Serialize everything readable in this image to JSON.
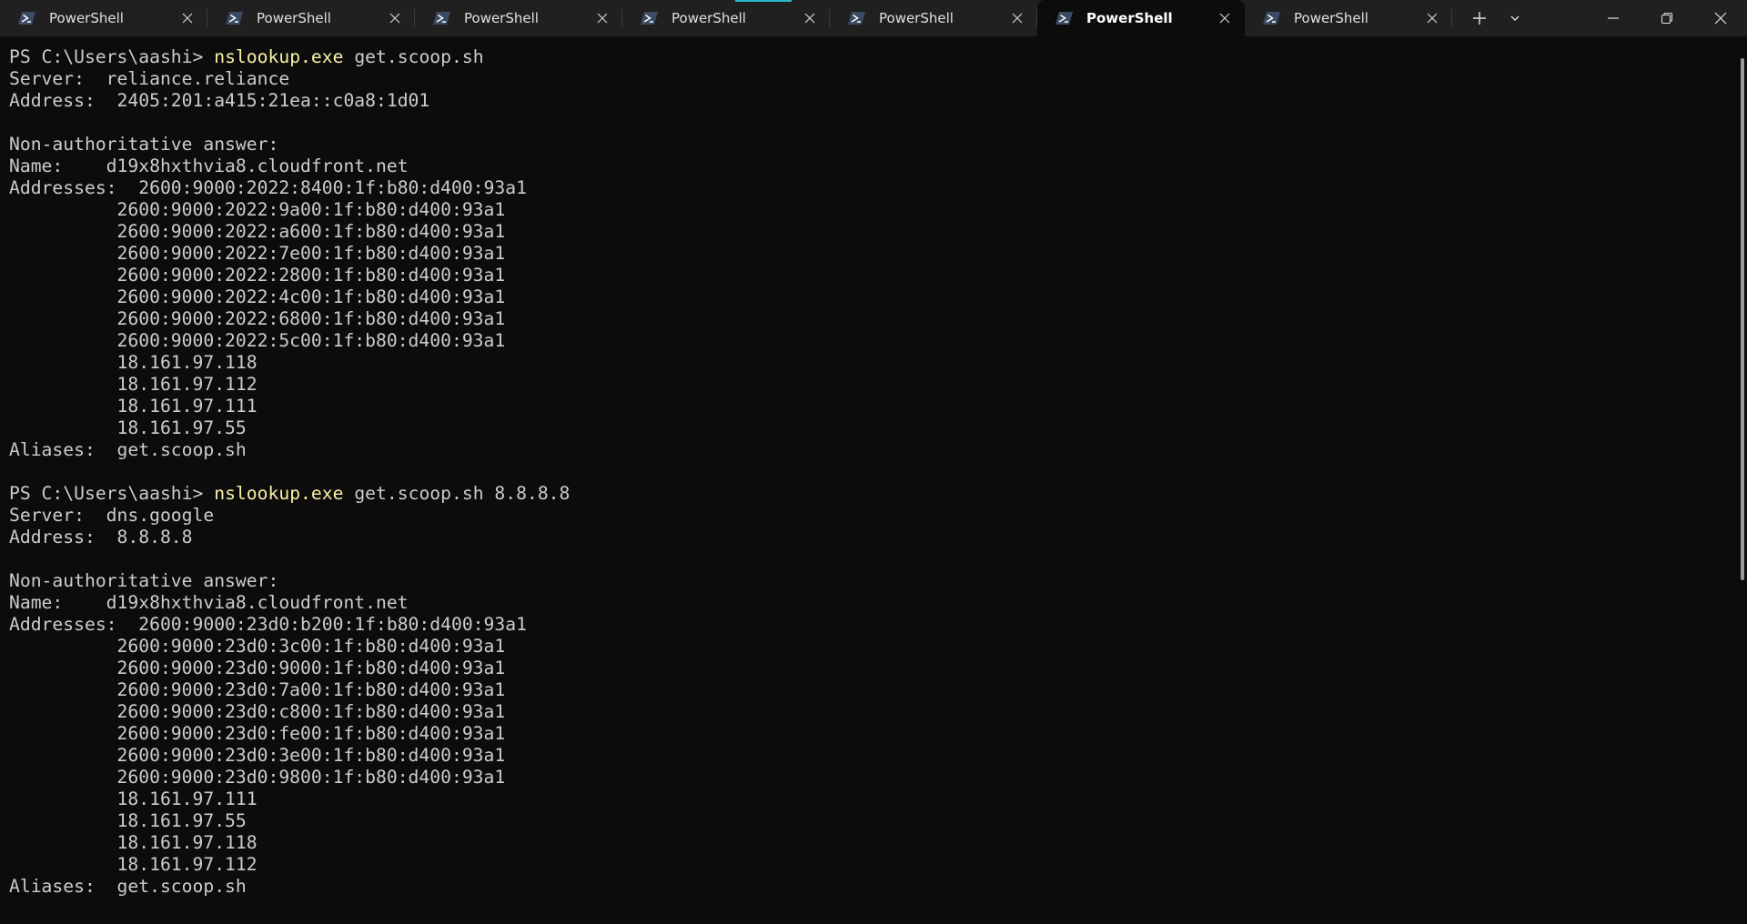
{
  "window": {
    "tabs": [
      {
        "label": "PowerShell",
        "active": false
      },
      {
        "label": "PowerShell",
        "active": false
      },
      {
        "label": "PowerShell",
        "active": false
      },
      {
        "label": "PowerShell",
        "active": false
      },
      {
        "label": "PowerShell",
        "active": false
      },
      {
        "label": "PowerShell",
        "active": true
      },
      {
        "label": "PowerShell",
        "active": false
      }
    ],
    "icons": {
      "tab_icon": "powershell-icon",
      "tab_close": "close-icon",
      "new_tab": "plus-icon",
      "dropdown": "chevron-down-icon",
      "minimize": "minimize-icon",
      "maximize": "restore-icon",
      "close": "close-icon"
    },
    "colors": {
      "background": "#0c0c0c",
      "titlebar": "#202020",
      "text": "#cccccc",
      "command": "#f9f1a5",
      "accent": "#2bb8c8"
    }
  },
  "terminal": {
    "lines": [
      {
        "pre": "PS C:\\Users\\aashi> ",
        "cmd": "nslookup.exe",
        "post": " get.scoop.sh"
      },
      {
        "pre": "Server:  reliance.reliance"
      },
      {
        "pre": "Address:  2405:201:a415:21ea::c0a8:1d01"
      },
      {
        "pre": ""
      },
      {
        "pre": "Non-authoritative answer:"
      },
      {
        "pre": "Name:    d19x8hxthvia8.cloudfront.net"
      },
      {
        "pre": "Addresses:  2600:9000:2022:8400:1f:b80:d400:93a1"
      },
      {
        "pre": "          2600:9000:2022:9a00:1f:b80:d400:93a1"
      },
      {
        "pre": "          2600:9000:2022:a600:1f:b80:d400:93a1"
      },
      {
        "pre": "          2600:9000:2022:7e00:1f:b80:d400:93a1"
      },
      {
        "pre": "          2600:9000:2022:2800:1f:b80:d400:93a1"
      },
      {
        "pre": "          2600:9000:2022:4c00:1f:b80:d400:93a1"
      },
      {
        "pre": "          2600:9000:2022:6800:1f:b80:d400:93a1"
      },
      {
        "pre": "          2600:9000:2022:5c00:1f:b80:d400:93a1"
      },
      {
        "pre": "          18.161.97.118"
      },
      {
        "pre": "          18.161.97.112"
      },
      {
        "pre": "          18.161.97.111"
      },
      {
        "pre": "          18.161.97.55"
      },
      {
        "pre": "Aliases:  get.scoop.sh"
      },
      {
        "pre": ""
      },
      {
        "pre": "PS C:\\Users\\aashi> ",
        "cmd": "nslookup.exe",
        "post": " get.scoop.sh 8.8.8.8"
      },
      {
        "pre": "Server:  dns.google"
      },
      {
        "pre": "Address:  8.8.8.8"
      },
      {
        "pre": ""
      },
      {
        "pre": "Non-authoritative answer:"
      },
      {
        "pre": "Name:    d19x8hxthvia8.cloudfront.net"
      },
      {
        "pre": "Addresses:  2600:9000:23d0:b200:1f:b80:d400:93a1"
      },
      {
        "pre": "          2600:9000:23d0:3c00:1f:b80:d400:93a1"
      },
      {
        "pre": "          2600:9000:23d0:9000:1f:b80:d400:93a1"
      },
      {
        "pre": "          2600:9000:23d0:7a00:1f:b80:d400:93a1"
      },
      {
        "pre": "          2600:9000:23d0:c800:1f:b80:d400:93a1"
      },
      {
        "pre": "          2600:9000:23d0:fe00:1f:b80:d400:93a1"
      },
      {
        "pre": "          2600:9000:23d0:3e00:1f:b80:d400:93a1"
      },
      {
        "pre": "          2600:9000:23d0:9800:1f:b80:d400:93a1"
      },
      {
        "pre": "          18.161.97.111"
      },
      {
        "pre": "          18.161.97.55"
      },
      {
        "pre": "          18.161.97.118"
      },
      {
        "pre": "          18.161.97.112"
      },
      {
        "pre": "Aliases:  get.scoop.sh"
      }
    ]
  }
}
